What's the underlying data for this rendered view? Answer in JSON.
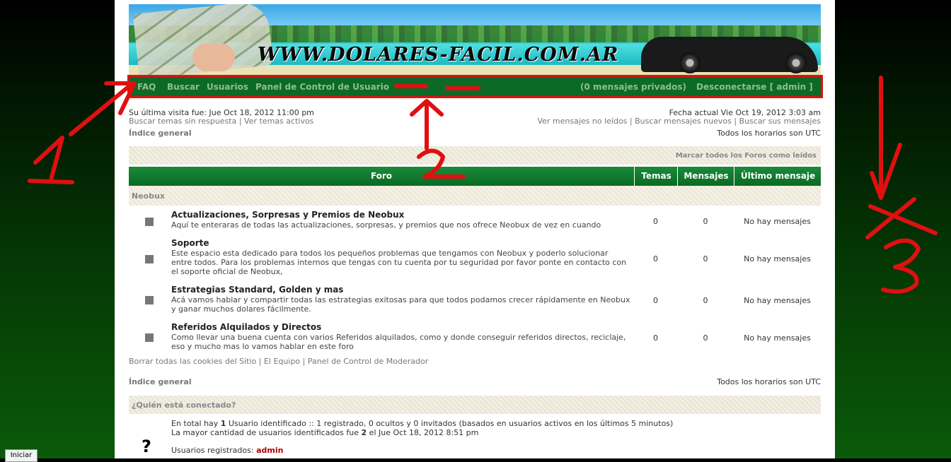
{
  "banner": {
    "logo_text": "WWW.DOLARES-FACIL.COM.AR"
  },
  "nav": {
    "faq": "FAQ",
    "search": "Buscar",
    "users": "Usuarios",
    "ucp": "Panel de Control de Usuario",
    "pm": "(0 mensajes privados)",
    "logout": "Desconectarse [ admin ]"
  },
  "info": {
    "last_visit": "Su última visita fue: Jue Oct 18, 2012 11:00 pm",
    "links_left": "Buscar temas sin respuesta | Ver temas activos",
    "current_date": "Fecha actual Vie Oct 19, 2012 3:03 am",
    "links_right": "Ver mensajes no leídos | Buscar mensajes nuevos | Buscar sus mensajes",
    "index": "Índice general",
    "timezone": "Todos los horarios son UTC",
    "mark_all": "Marcar todos los Foros como leídos"
  },
  "table": {
    "headers": [
      "Foro",
      "Temas",
      "Mensajes",
      "Último mensaje"
    ],
    "category": "Neobux",
    "forums": [
      {
        "title": "Actualizaciones, Sorpresas y Premios de Neobux",
        "desc": "Aquí te enteraras de todas las actualizaciones, sorpresas, y premios que nos ofrece Neobux de vez en cuando",
        "topics": "0",
        "posts": "0",
        "last": "No hay mensajes"
      },
      {
        "title": "Soporte",
        "desc": "Este espacio esta dedicado para todos los pequeños problemas que tengamos con Neobux y poderlo solucionar entre todos. Para los problemas internos que tengas con tu cuenta por tu seguridad por favor ponte en contacto con el soporte oficial de Neobux,",
        "topics": "0",
        "posts": "0",
        "last": "No hay mensajes"
      },
      {
        "title": "Estrategias Standard, Golden y mas",
        "desc": "Acá vamos hablar y compartir todas las estrategias exitosas para que todos podamos crecer rápidamente en Neobux y ganar muchos dolares fácilmente.",
        "topics": "0",
        "posts": "0",
        "last": "No hay mensajes"
      },
      {
        "title": "Referidos Alquilados y Directos",
        "desc": "Como llevar una buena cuenta con varios Referidos alquilados, como y donde conseguir referidos directos, reciclaje, eso y mucho mas lo vamos hablar en este foro",
        "topics": "0",
        "posts": "0",
        "last": "No hay mensajes"
      }
    ]
  },
  "footer": {
    "links": "Borrar todas las cookies del Sitio | El Equipo | Panel de Control de Moderador",
    "index": "Índice general",
    "timezone": "Todos los horarios son UTC"
  },
  "who": {
    "title": "¿Quién está conectado?",
    "line1_pre": "En total hay ",
    "line1_n": "1",
    "line1_post": " Usuario identificado :: 1 registrado, 0 ocultos y 0 invitados (basados en usuarios activos en los últimos 5 minutos)",
    "line2_pre": "La mayor cantidad de usuarios identificados fue ",
    "line2_n": "2",
    "line2_post": " el Jue Oct 18, 2012 8:51 pm",
    "registered_label": "Usuarios registrados: ",
    "registered_user": "admin"
  },
  "taskbar": {
    "start": "Iniciar"
  },
  "colors": {
    "nav_bg": "#0b6a26",
    "header_bg": "#086a22",
    "annotation_red": "#e01010",
    "user_color": "#aa0000"
  }
}
